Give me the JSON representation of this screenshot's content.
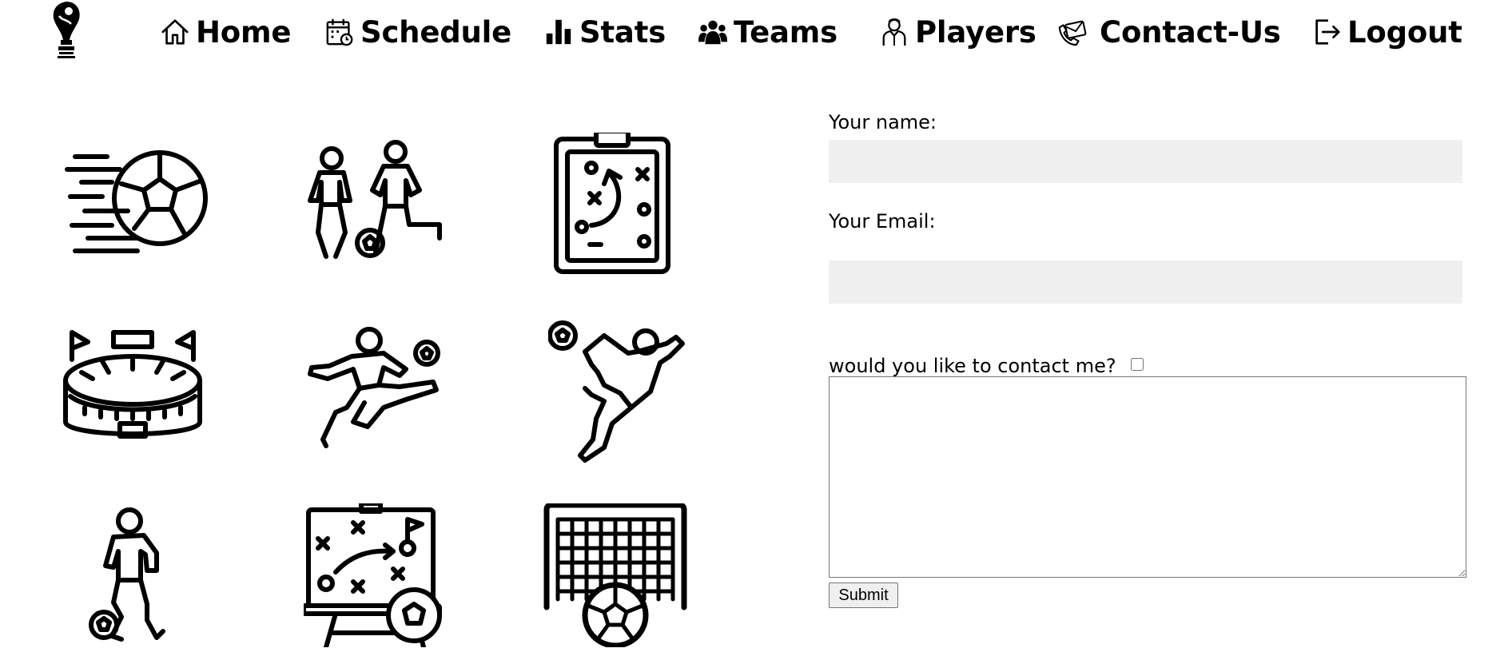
{
  "nav": {
    "logo_icon": "world-cup-trophy-icon",
    "items": [
      {
        "label": "Home",
        "icon": "home-icon"
      },
      {
        "label": "Schedule",
        "icon": "calendar-icon"
      },
      {
        "label": "Stats",
        "icon": "bar-chart-icon"
      },
      {
        "label": "Teams",
        "icon": "users-group-icon"
      },
      {
        "label": "Players",
        "icon": "player-icon"
      },
      {
        "label": "Contact-Us",
        "icon": "phone-envelope-icon"
      },
      {
        "label": "Logout",
        "icon": "logout-icon"
      }
    ]
  },
  "gallery": [
    "flying-soccer-ball-icon",
    "two-players-icon",
    "tactics-clipboard-icon",
    "stadium-icon",
    "player-kicking-icon",
    "goalkeeper-diving-icon",
    "player-dribbling-icon",
    "tactics-whiteboard-icon",
    "goal-net-ball-icon"
  ],
  "form": {
    "name_label": "Your name:",
    "name_value": "",
    "email_label": "Your Email:",
    "email_value": "",
    "contact_label": "would you like to contact me?",
    "contact_checked": false,
    "message_value": "",
    "submit_label": "Submit"
  },
  "colors": {
    "field_background": "#f0f0f0",
    "text": "#000000"
  }
}
